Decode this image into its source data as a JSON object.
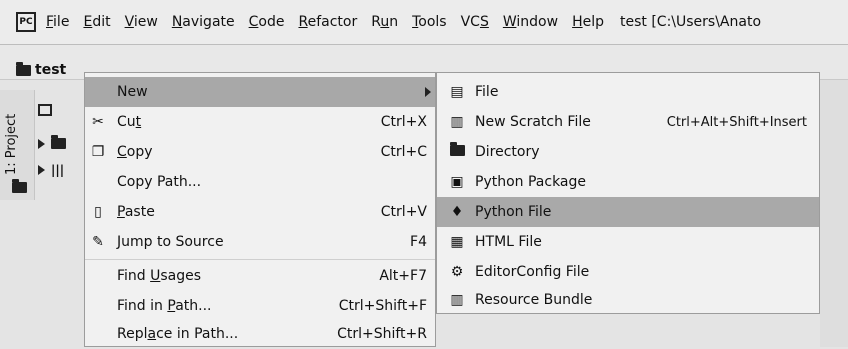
{
  "app": {
    "icon": "PC",
    "window_title": "test [C:\\Users\\Anato"
  },
  "menubar": [
    {
      "pre": "",
      "u": "F",
      "post": "ile"
    },
    {
      "pre": "",
      "u": "E",
      "post": "dit"
    },
    {
      "pre": "",
      "u": "V",
      "post": "iew"
    },
    {
      "pre": "",
      "u": "N",
      "post": "avigate"
    },
    {
      "pre": "",
      "u": "C",
      "post": "ode"
    },
    {
      "pre": "",
      "u": "R",
      "post": "efactor"
    },
    {
      "pre": "R",
      "u": "u",
      "post": "n"
    },
    {
      "pre": "",
      "u": "T",
      "post": "ools"
    },
    {
      "pre": "VC",
      "u": "S",
      "post": ""
    },
    {
      "pre": "",
      "u": "W",
      "post": "indow"
    },
    {
      "pre": "",
      "u": "H",
      "post": "elp"
    }
  ],
  "project": {
    "root": "test",
    "side_tab": "1: Project"
  },
  "context_menu": {
    "new": {
      "label": "New"
    },
    "cut": {
      "pre": "Cu",
      "u": "t",
      "post": "",
      "shortcut": "Ctrl+X"
    },
    "copy": {
      "pre": "",
      "u": "C",
      "post": "opy",
      "shortcut": "Ctrl+C"
    },
    "copy_path": {
      "label": "Copy Path..."
    },
    "paste": {
      "pre": "",
      "u": "P",
      "post": "aste",
      "shortcut": "Ctrl+V"
    },
    "jump": {
      "label": "Jump to Source",
      "shortcut": "F4"
    },
    "find_usages": {
      "pre": "Find ",
      "u": "U",
      "post": "sages",
      "shortcut": "Alt+F7"
    },
    "find_in_path": {
      "pre": "Find in ",
      "u": "P",
      "post": "ath...",
      "shortcut": "Ctrl+Shift+F"
    },
    "replace_in_path": {
      "pre": "Repl",
      "u": "a",
      "post": "ce in Path...",
      "shortcut": "Ctrl+Shift+R"
    }
  },
  "submenu": {
    "file": {
      "label": "File",
      "icon": "file-icon"
    },
    "scratch": {
      "label": "New Scratch File",
      "shortcut": "Ctrl+Alt+Shift+Insert",
      "icon": "scratch-file-icon"
    },
    "directory": {
      "label": "Directory",
      "icon": "folder-icon"
    },
    "python_package": {
      "label": "Python Package",
      "icon": "package-icon"
    },
    "python_file": {
      "label": "Python File",
      "icon": "python-icon"
    },
    "html_file": {
      "label": "HTML File",
      "icon": "html-icon"
    },
    "editorconfig": {
      "label": "EditorConfig File",
      "icon": "gear-icon"
    },
    "resource_bundle": {
      "label": "Resource Bundle",
      "icon": "resource-bundle-icon"
    }
  }
}
